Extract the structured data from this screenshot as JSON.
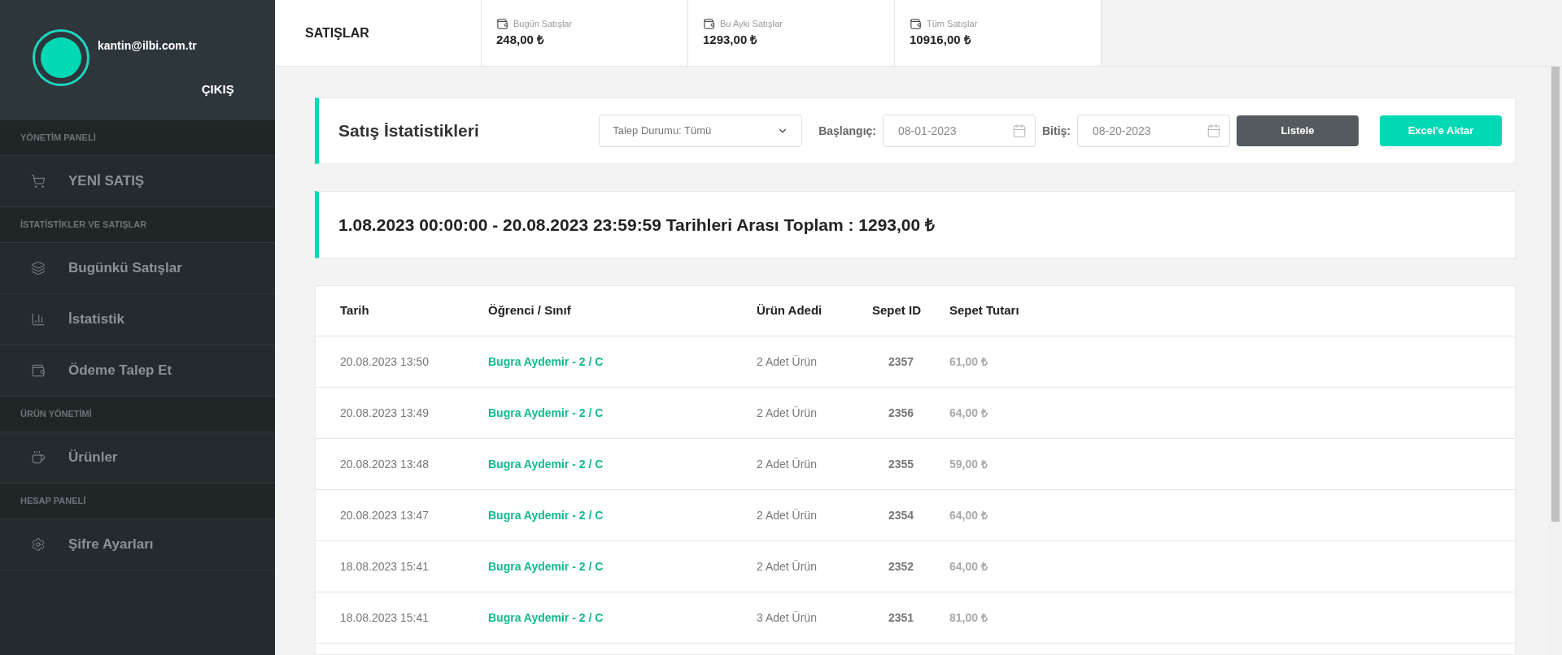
{
  "profile": {
    "email": "kantin@ilbi.com.tr",
    "logout": "ÇIKIŞ"
  },
  "sidebar": {
    "sections": [
      {
        "title": "YÖNETİM PANELİ",
        "items": [
          {
            "label": "YENİ SATIŞ"
          }
        ]
      },
      {
        "title": "İSTATİSTİKLER VE SATIŞLAR",
        "items": [
          {
            "label": "Bugünkü Satışlar"
          },
          {
            "label": "İstatistik"
          },
          {
            "label": "Ödeme Talep Et"
          }
        ]
      },
      {
        "title": "ÜRÜN YÖNETİMİ",
        "items": [
          {
            "label": "Ürünler"
          }
        ]
      },
      {
        "title": "HESAP PANELİ",
        "items": [
          {
            "label": "Şifre Ayarları"
          }
        ]
      }
    ]
  },
  "header": {
    "title": "SATIŞLAR",
    "stats": [
      {
        "label": "Bugün Satışlar",
        "value": "248,00 ₺"
      },
      {
        "label": "Bu Ayki Satışlar",
        "value": "1293,00 ₺"
      },
      {
        "label": "Tüm Satışlar",
        "value": "10916,00 ₺"
      }
    ]
  },
  "filter": {
    "title": "Satış İstatistikleri",
    "status_select": "Talep Durumu: Tümü",
    "start_label": "Başlangıç:",
    "start_value": "08-01-2023",
    "end_label": "Bitiş:",
    "end_value": "08-20-2023",
    "list_button": "Listele",
    "export_button": "Excel'e Aktar"
  },
  "summary": "1.08.2023 00:00:00 - 20.08.2023 23:59:59 Tarihleri Arası Toplam : 1293,00 ₺",
  "table": {
    "columns": [
      "Tarih",
      "Öğrenci / Sınıf",
      "Ürün Adedi",
      "Sepet ID",
      "Sepet Tutarı"
    ],
    "rows": [
      [
        "20.08.2023 13:50",
        "Bugra Aydemir - 2 / C",
        "2 Adet Ürün",
        "2357",
        "61,00 ₺"
      ],
      [
        "20.08.2023 13:49",
        "Bugra Aydemir - 2 / C",
        "2 Adet Ürün",
        "2356",
        "64,00 ₺"
      ],
      [
        "20.08.2023 13:48",
        "Bugra Aydemir - 2 / C",
        "2 Adet Ürün",
        "2355",
        "59,00 ₺"
      ],
      [
        "20.08.2023 13:47",
        "Bugra Aydemir - 2 / C",
        "2 Adet Ürün",
        "2354",
        "64,00 ₺"
      ],
      [
        "18.08.2023 15:41",
        "Bugra Aydemir - 2 / C",
        "2 Adet Ürün",
        "2352",
        "64,00 ₺"
      ],
      [
        "18.08.2023 15:41",
        "Bugra Aydemir - 2 / C",
        "3 Adet Ürün",
        "2351",
        "81,00 ₺"
      ]
    ]
  }
}
